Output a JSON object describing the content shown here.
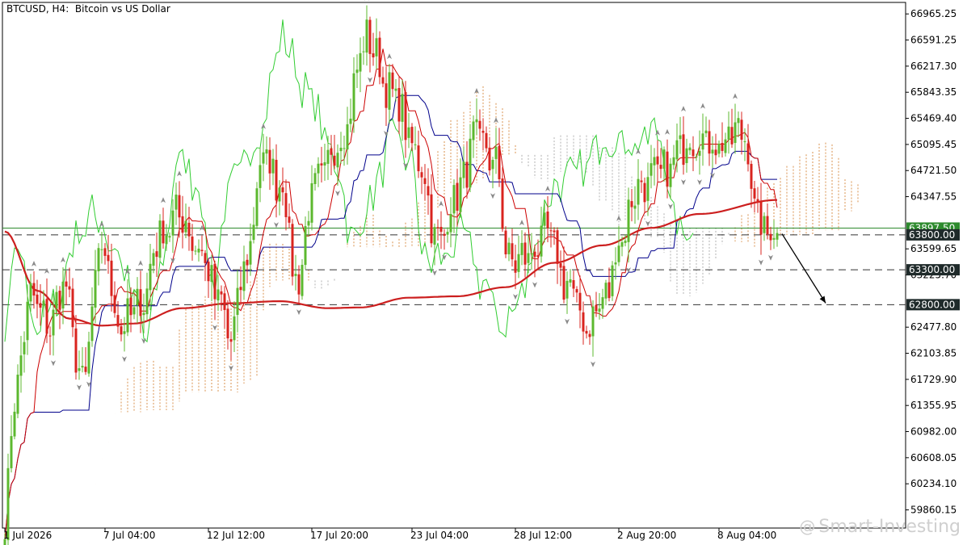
{
  "header": {
    "symbol": "BTCUSD",
    "timeframe": "H4:",
    "description": "Bitcoin vs US Dollar"
  },
  "watermark": {
    "symbol": "@",
    "text": "Smart-Investing"
  },
  "colors": {
    "bull": "#5cb82f",
    "bear": "#d9241f",
    "tenkan": "#cc0000",
    "kijun": "#00008b",
    "chikou": "#32cd32",
    "ma": "#cc1f1f",
    "cloud_up": "#d9914d",
    "cloud_down": "#b0b0b0",
    "price_line": "#2e8b2e",
    "label_bg": "#1f2a2a"
  },
  "chart_data": {
    "type": "candlestick",
    "symbol": "BTCUSD",
    "timeframe": "H4",
    "title": "BTCUSD, H4:  Bitcoin vs US Dollar",
    "ylim": [
      59600,
      67130
    ],
    "y_ticks": [
      "66965.25",
      "66591.25",
      "66217.30",
      "65843.35",
      "65469.40",
      "65095.45",
      "64721.50",
      "64347.55",
      "63599.65",
      "63225.70",
      "62477.80",
      "62103.85",
      "61729.90",
      "61355.95",
      "60982.00",
      "60608.05",
      "60234.10",
      "59860.15"
    ],
    "x_ticks": [
      "1 Jul 2026",
      "7 Jul 04:00",
      "12 Jul 12:00",
      "17 Jul 20:00",
      "23 Jul 04:00",
      "28 Jul 12:00",
      "2 Aug 20:00",
      "8 Aug 04:00"
    ],
    "x_tick_index": [
      0,
      31,
      63,
      95,
      126,
      158,
      190,
      221
    ],
    "current_price": {
      "label": "63897.50",
      "value": 63897.5
    },
    "levels": [
      {
        "label": "63800.00",
        "value": 63800
      },
      {
        "label": "63300.00",
        "value": 63300
      },
      {
        "label": "62800.00",
        "value": 62800
      }
    ],
    "anchors": [
      [
        0,
        59700
      ],
      [
        3,
        61500
      ],
      [
        8,
        62900
      ],
      [
        14,
        62500
      ],
      [
        18,
        63100
      ],
      [
        24,
        61700
      ],
      [
        30,
        63600
      ],
      [
        36,
        62500
      ],
      [
        42,
        62800
      ],
      [
        48,
        63800
      ],
      [
        54,
        64100
      ],
      [
        60,
        63600
      ],
      [
        66,
        62900
      ],
      [
        70,
        62300
      ],
      [
        74,
        63300
      ],
      [
        80,
        64900
      ],
      [
        86,
        64500
      ],
      [
        90,
        63100
      ],
      [
        96,
        64500
      ],
      [
        104,
        65200
      ],
      [
        112,
        66600
      ],
      [
        120,
        65800
      ],
      [
        128,
        64900
      ],
      [
        134,
        63700
      ],
      [
        140,
        64400
      ],
      [
        146,
        65200
      ],
      [
        152,
        64800
      ],
      [
        156,
        63400
      ],
      [
        162,
        63500
      ],
      [
        168,
        63800
      ],
      [
        174,
        63100
      ],
      [
        180,
        62500
      ],
      [
        186,
        62900
      ],
      [
        190,
        63700
      ],
      [
        196,
        64500
      ],
      [
        204,
        64700
      ],
      [
        212,
        65200
      ],
      [
        222,
        65100
      ],
      [
        228,
        65300
      ],
      [
        234,
        63900
      ],
      [
        238,
        63850
      ]
    ],
    "ma_anchors": [
      [
        0,
        63850
      ],
      [
        10,
        63000
      ],
      [
        20,
        62600
      ],
      [
        30,
        62500
      ],
      [
        40,
        62530
      ],
      [
        55,
        62750
      ],
      [
        70,
        62820
      ],
      [
        85,
        62850
      ],
      [
        100,
        62750
      ],
      [
        110,
        62760
      ],
      [
        125,
        62900
      ],
      [
        140,
        62920
      ],
      [
        155,
        63050
      ],
      [
        170,
        63400
      ],
      [
        185,
        63650
      ],
      [
        200,
        63900
      ],
      [
        215,
        64100
      ],
      [
        239,
        64300
      ]
    ],
    "forecast_arrow": {
      "from": [
        240,
        63850
      ],
      "to": [
        253,
        62800
      ]
    },
    "grid": false,
    "series": [
      {
        "name": "Price",
        "kind": "candles"
      },
      {
        "name": "MA",
        "kind": "line"
      },
      {
        "name": "Tenkan-sen",
        "kind": "line"
      },
      {
        "name": "Kijun-sen",
        "kind": "line"
      },
      {
        "name": "Chikou Span",
        "kind": "line"
      },
      {
        "name": "Kumo",
        "kind": "cloud"
      }
    ]
  }
}
